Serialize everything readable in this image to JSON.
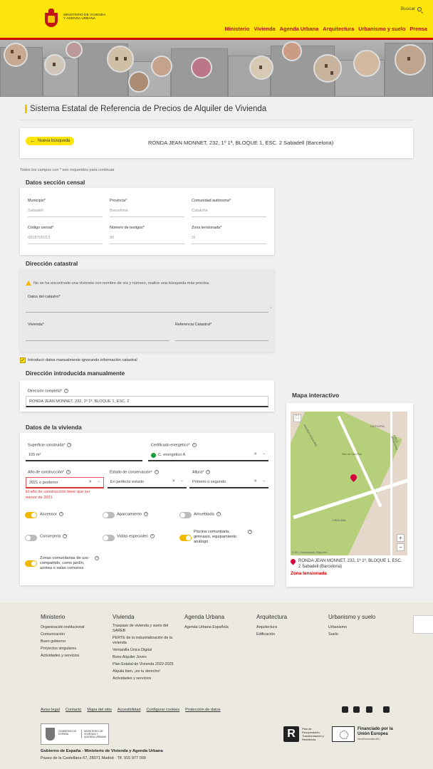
{
  "header": {
    "logo_text": "MINISTERIO DE VIVIENDA Y AGENDA URBANA",
    "search_label": "Buscar",
    "nav": [
      "Ministerio",
      "Vivienda",
      "Agenda Urbana",
      "Arquitectura",
      "Urbanismo y suelo",
      "Prensa"
    ]
  },
  "page_title": "Sistema Estatal de Referencia de Precios de Alquiler de Vivienda",
  "address_bar": {
    "back_button": "Nueva búsqueda",
    "address": "RONDA JEAN MONNET, 232, 1º 1ª, BLOQUE 1, ESC. 2 Sabadell (Barcelona)"
  },
  "required_note": "Todos los campos con * son requeridos para continuar",
  "datos_censal": {
    "title": "Datos sección censal",
    "municipio_label": "Municipio*",
    "municipio_value": "Sabadell",
    "provincia_label": "Provincia*",
    "provincia_value": "Barcelona",
    "comunidad_label": "Comunidad autónoma*",
    "comunidad_value": "Cataluña",
    "codigo_label": "Código censal*",
    "codigo_value": "0818705013",
    "testigos_label": "Número de testigos*",
    "testigos_value": "90",
    "zona_label": "Zona tensionada*",
    "zona_value": "Sí"
  },
  "direccion_catastral": {
    "title": "Dirección catastral",
    "warning": "No se ha encontrado una vivienda con nombre de vía y número, realice una búsqueda más precisa.",
    "catastro_label": "Datos del catastro*",
    "vivienda_label": "Vivienda*",
    "referencia_label": "Referencia Catastral*"
  },
  "manual_checkbox": {
    "label": "Introducir datos manualmente ignorando información catastral",
    "checked": true
  },
  "direccion_manual": {
    "title": "Dirección introducida manualmente",
    "label": "Dirección completa*",
    "value": "RONDA JEAN MONNET, 232, 1º 1ª, BLOQUE 1, ESC. 2"
  },
  "datos_vivienda": {
    "title": "Datos de la vivienda",
    "superficie_label": "Superficie construida*",
    "superficie_value": "105 m²",
    "certificado_label": "Certificado energético*",
    "certificado_value": "C. energético A",
    "anio_label": "Año de construcción*",
    "anio_value": "2021 o posterior",
    "anio_error": "El año de construcción tiene que ser menor de 2021",
    "estado_label": "Estado de conservación*",
    "estado_value": "En perfecto estado",
    "altura_label": "Altura*",
    "altura_value": "Primero o segundo",
    "toggles": [
      {
        "label": "Ascensor",
        "on": true
      },
      {
        "label": "Aparcamiento",
        "on": false
      },
      {
        "label": "Amueblada",
        "on": false
      },
      {
        "label": "Conserjería",
        "on": false
      },
      {
        "label": "Vistas especiales",
        "on": false
      },
      {
        "label": "Piscina comunitaria, gimnasio, equipamiento análogo",
        "on": true
      },
      {
        "label": "Zonas comunitarias de uso compartido, como jardín, azotea o salas comunes",
        "on": true
      }
    ]
  },
  "mapa": {
    "title": "Mapa interactivo",
    "address": "RONDA JEAN MONNET, 232, 1º 1ª, BLOQUE 1, ESC. 2 Sabadell (Barcelona)",
    "zona": "Zona tensionada",
    "attribution": "ICGC | Cartociudad | MapLibre",
    "zoom_in": "+",
    "zoom_out": "−",
    "streets": [
      "PASSEIG ROSA BRÖ",
      "C/ETIOPIA",
      "CALLE ARGENTINA",
      "Parc de Sant Pau",
      "C/BOLIBIA"
    ]
  },
  "footer": {
    "cols": [
      {
        "title": "Ministerio",
        "items": [
          "Organización institucional",
          "Comunicación",
          "Buen gobierno",
          "Proyectos singulares",
          "Actividades y servicios"
        ]
      },
      {
        "title": "Vivienda",
        "items": [
          "Traspaso de vivienda y suelo del SAREB",
          "PERTE de la industrialización de la vivienda",
          "Ventanilla Única Digital",
          "Bono Alquiler Joven",
          "Plan Estatal de Vivienda 2022-2025",
          "Alquila bien, ¡es tu derecho!",
          "Actividades y servicios"
        ]
      },
      {
        "title": "Agenda Urbana",
        "items": [
          "Agenda Urbana Española"
        ]
      },
      {
        "title": "Arquitectura",
        "items": [
          "Arquitectura",
          "Edificación"
        ]
      },
      {
        "title": "Urbanismo y suelo",
        "items": [
          "Urbanismo",
          "Suelo"
        ]
      }
    ],
    "links": [
      "Aviso legal",
      "Contacto",
      "Mapa del sitio",
      "Accesibilidad",
      "Configurar cookies",
      "Protección de datos"
    ],
    "gov_logo_left": "GOBIERNO DE ESPAÑA",
    "gov_logo_right": "MINISTERIO DE VIVIENDA Y AGENDA URBANA",
    "gov_name": "Gobierno de España - Ministerio de Vivienda y Agenda Urbana",
    "gov_address": "Paseo de la Castellana 67, 28071 Madrid · Tlf. 915 977 000",
    "prtr_text": "Plan de Recuperación, Transformación y Resiliencia",
    "eu_title": "Financiado por la Unión Europea",
    "eu_sub": "NextGenerationEU"
  }
}
